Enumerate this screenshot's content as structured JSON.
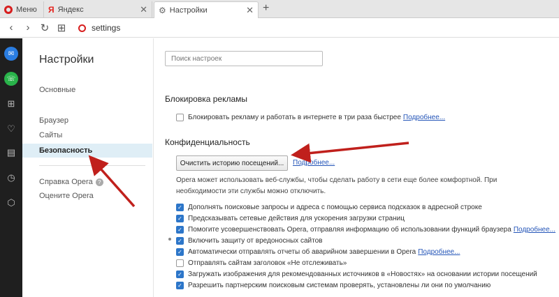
{
  "tabs": {
    "menu_label": "Меню",
    "yandex_label": "Яндекс",
    "settings_label": "Настройки",
    "yandex_icon_text": "Я"
  },
  "toolbar": {
    "address": "settings"
  },
  "nav": {
    "title": "Настройки",
    "items": [
      "Основные",
      "Браузер",
      "Сайты",
      "Безопасность"
    ],
    "help_label": "Справка Opera",
    "rate_label": "Оцените Opera",
    "help_icon_text": "?"
  },
  "main": {
    "search_placeholder": "Поиск настроек",
    "adblock": {
      "title": "Блокировка рекламы",
      "label": "Блокировать рекламу и работать в интернете в три раза быстрее",
      "link": "Подробнее..."
    },
    "privacy": {
      "title": "Конфиденциальность",
      "clear_button": "Очистить историю посещений...",
      "link": "Подробнее...",
      "description": "Opera может использовать веб-службы, чтобы сделать работу в сети еще более комфортной. При необходимости эти службы можно отключить.",
      "options": [
        {
          "label": "Дополнять поисковые запросы и адреса с помощью сервиса подсказок в адресной строке",
          "checked": true,
          "link": ""
        },
        {
          "label": "Предсказывать сетевые действия для ускорения загрузки страниц",
          "checked": true,
          "link": ""
        },
        {
          "label": "Помогите усовершенствовать Opera, отправляя информацию об использовании функций браузера",
          "checked": true,
          "link": "Подробнее..."
        },
        {
          "label": "Включить защиту от вредоносных сайтов",
          "checked": true,
          "link": ""
        },
        {
          "label": "Автоматически отправлять отчеты об аварийном завершении в Opera",
          "checked": true,
          "link": "Подробнее..."
        },
        {
          "label": "Отправлять сайтам заголовок «Не отслеживать»",
          "checked": false,
          "link": ""
        },
        {
          "label": "Загружать изображения для рекомендованных источников в «Новостях» на основании истории посещений",
          "checked": true,
          "link": ""
        },
        {
          "label": "Разрешить партнерским поисковым системам проверять, установлены ли они по умолчанию",
          "checked": true,
          "link": ""
        }
      ]
    }
  },
  "colors": {
    "accent": "#2d76c9",
    "arrow": "#c0201c",
    "active_nav": "#dfeef6"
  }
}
